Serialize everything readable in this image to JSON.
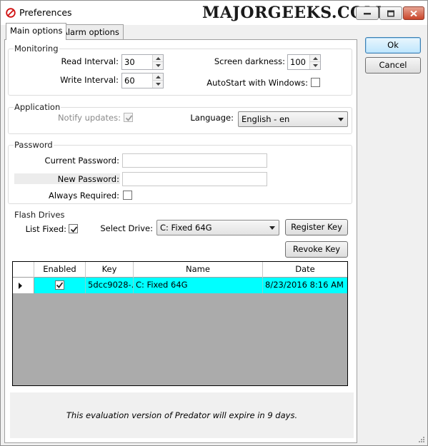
{
  "window": {
    "title": "Preferences"
  },
  "watermark": "MAJORGEEKS.COM",
  "tabs": [
    {
      "label": "Main options",
      "active": true
    },
    {
      "label": "Alarm options",
      "active": false
    }
  ],
  "monitoring": {
    "title": "Monitoring",
    "read_interval_label": "Read Interval:",
    "read_interval_value": "30",
    "write_interval_label": "Write Interval:",
    "write_interval_value": "60",
    "screen_darkness_label": "Screen darkness:",
    "screen_darkness_value": "100",
    "autostart_label": "AutoStart with Windows:",
    "autostart_checked": false
  },
  "application": {
    "title": "Application",
    "notify_updates_label": "Notify updates:",
    "notify_updates_checked": true,
    "language_label": "Language:",
    "language_value": "English - en"
  },
  "password": {
    "title": "Password",
    "current_label": "Current Password:",
    "current_value": "",
    "new_label": "New Password:",
    "new_value": "",
    "always_required_label": "Always Required:",
    "always_required_checked": false
  },
  "flash_drives": {
    "title": "Flash Drives",
    "list_fixed_label": "List Fixed:",
    "list_fixed_checked": true,
    "select_drive_label": "Select Drive:",
    "select_drive_value": "C: Fixed 64G",
    "register_key_label": "Register Key",
    "revoke_key_label": "Revoke Key",
    "table": {
      "columns": [
        "Enabled",
        "Key",
        "Name",
        "Date"
      ],
      "rows": [
        {
          "enabled": true,
          "key": "5dcc9028-...",
          "name": "C: Fixed 64G",
          "date": "8/23/2016 8:16 AM"
        }
      ]
    }
  },
  "notice": "This evaluation version of Predator will expire in 9 days.",
  "buttons": {
    "ok_label": "Ok",
    "cancel_label": "Cancel"
  },
  "colors": {
    "selected_row": "#00ffff",
    "grid_background": "#ababab",
    "close_button": "#c9452a"
  }
}
